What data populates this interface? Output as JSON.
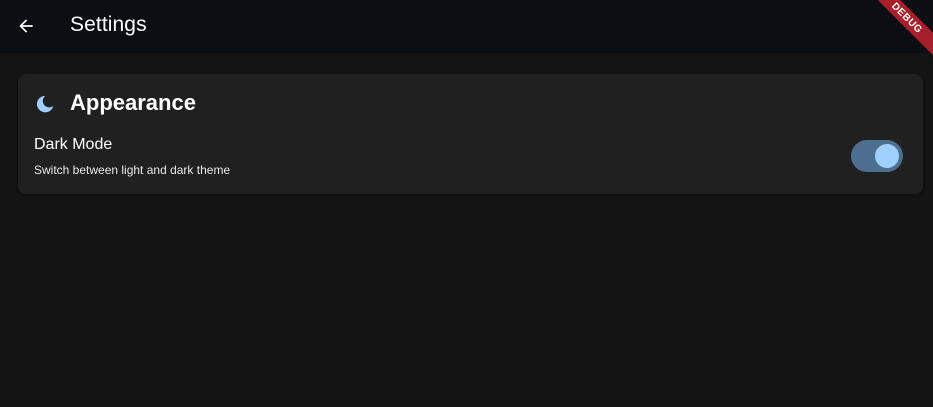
{
  "appbar": {
    "title": "Settings",
    "back_icon": "arrow-back-icon"
  },
  "debug_banner": {
    "label": "DEBUG",
    "color": "#a5202a"
  },
  "appearance_section": {
    "icon": "moon-icon",
    "icon_color": "#9fd0ff",
    "title": "Appearance",
    "dark_mode": {
      "label": "Dark Mode",
      "description": "Switch between light and dark theme",
      "enabled": true
    }
  },
  "colors": {
    "background": "#141414",
    "appbar": "#0b0e13",
    "card": "#202020",
    "switch_track": "#4c6f8f",
    "switch_thumb": "#9fd0ff"
  }
}
